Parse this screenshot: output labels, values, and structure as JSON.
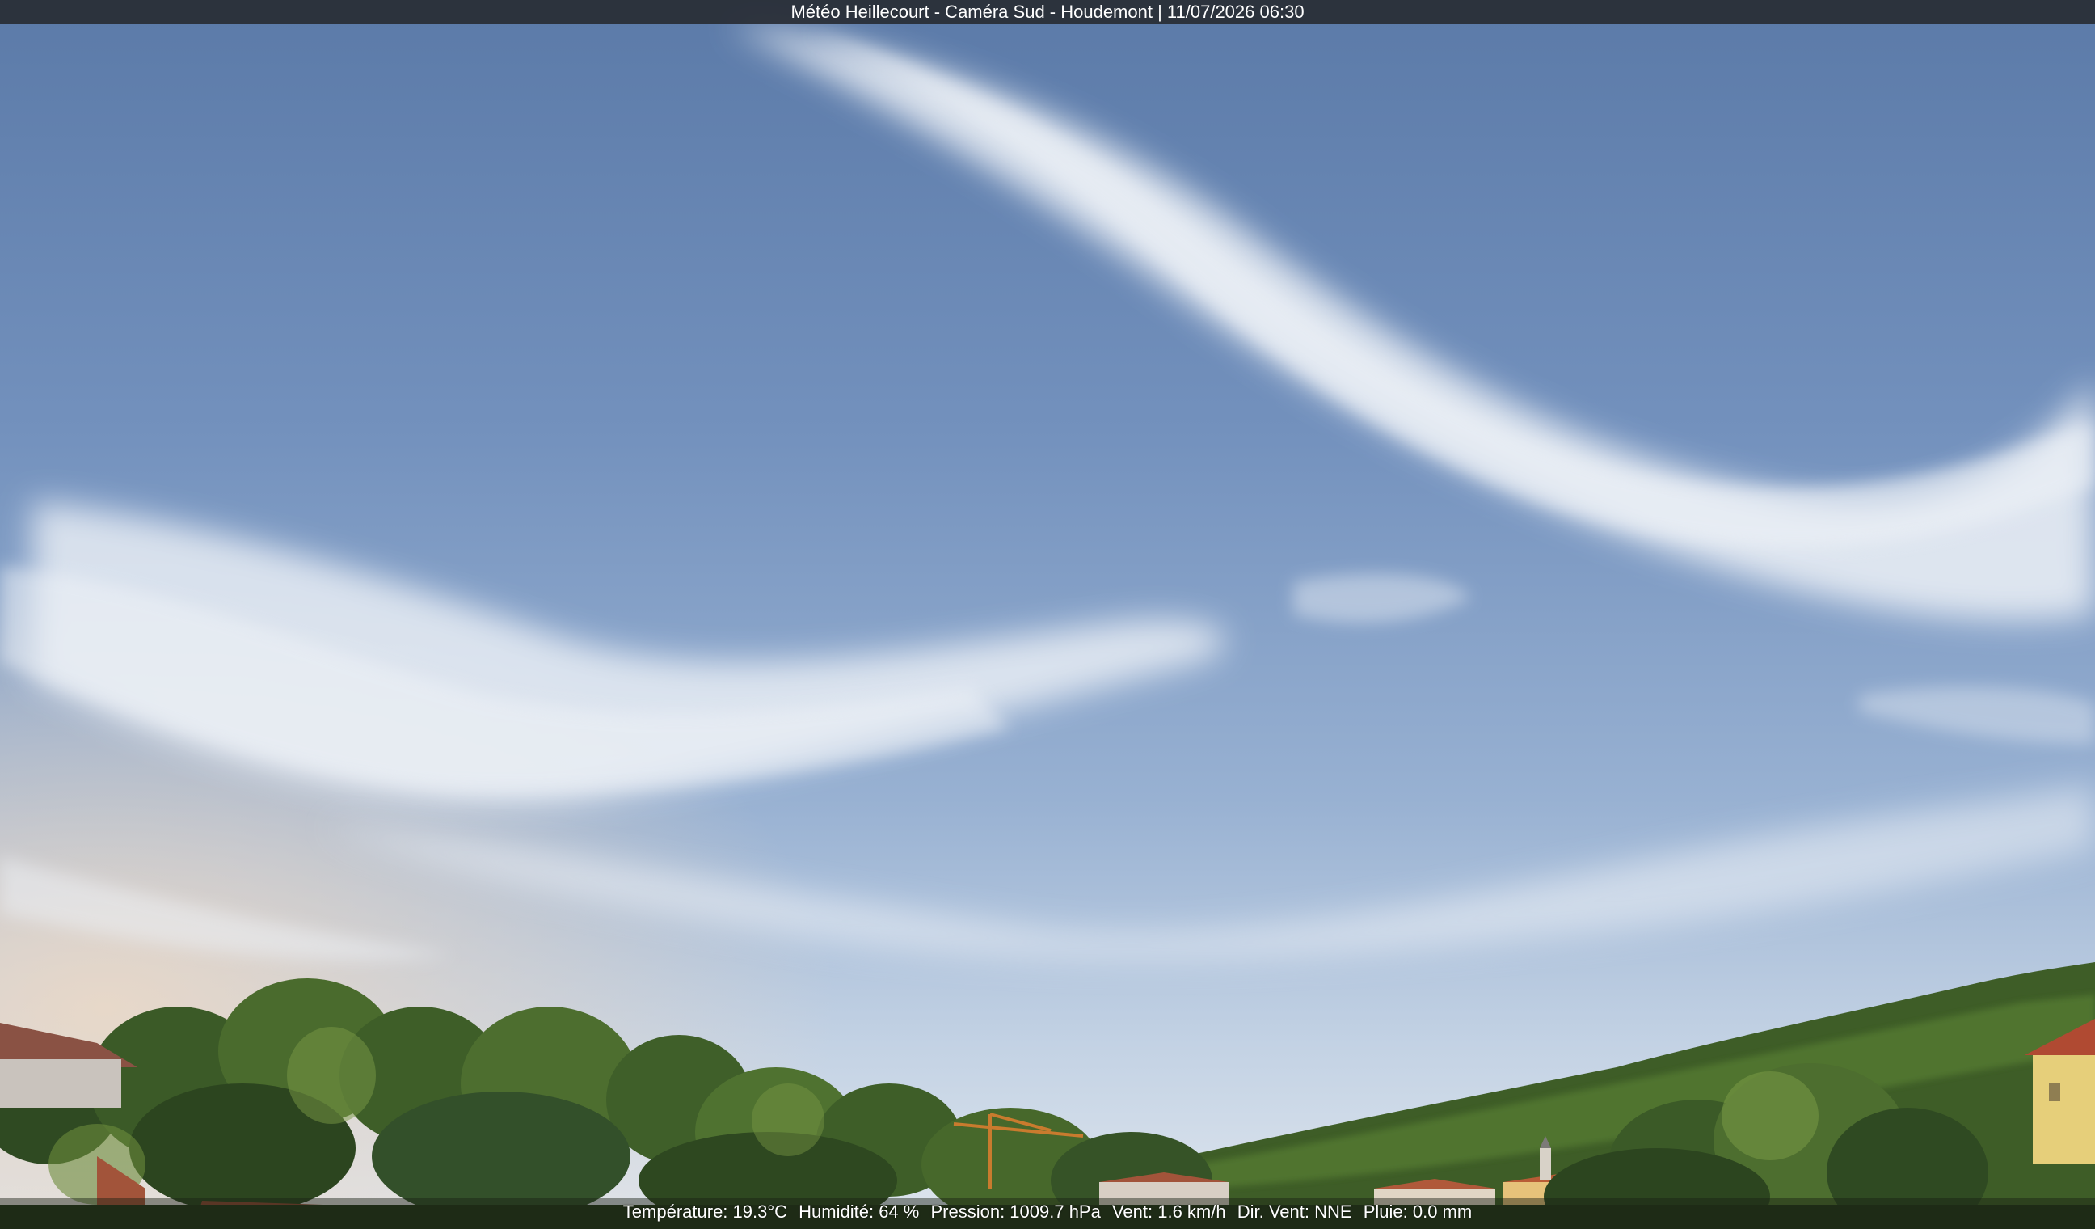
{
  "overlay": {
    "title": "Météo Heillecourt - Caméra Sud - Houdemont | 11/07/2026 06:30",
    "weather": {
      "temperature": "Température: 19.3°C",
      "humidity": "Humidité: 64 %",
      "pressure": "Pression: 1009.7 hPa",
      "wind_speed": "Vent: 1.6 km/h",
      "wind_direction": "Dir. Vent: NNE",
      "rain": "Pluie: 0.0 mm"
    }
  },
  "scene": {
    "description_icon": "webcam-landscape-icon",
    "colors": {
      "sky_top": "#5f7eab",
      "sky_mid": "#8aa6cc",
      "sky_horizon": "#cfd9e6",
      "haze_warm": "#e8d8c8",
      "cloud": "#eef2f7",
      "trees_dark": "#2f4a22",
      "trees_mid": "#4d6e2f",
      "trees_light": "#7a9a45",
      "hill": "#46662c",
      "roof": "#a2543a",
      "wall_yellow": "#e6cf7a",
      "crane": "#c97b2e"
    }
  }
}
